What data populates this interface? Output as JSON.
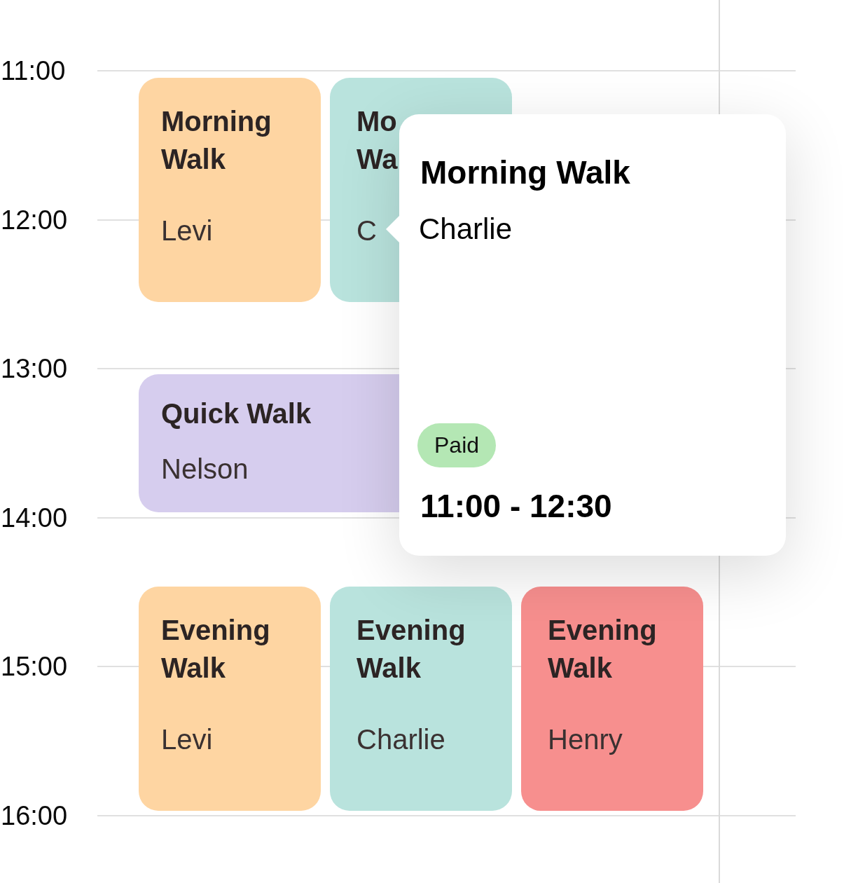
{
  "time_axis": {
    "labels": [
      "11:00",
      "12:00",
      "13:00",
      "14:00",
      "15:00",
      "16:00"
    ]
  },
  "event_rows": [
    {
      "events": [
        {
          "kind": "full",
          "title": "Morning Walk",
          "name": "Levi",
          "color": "#fed5a2"
        },
        {
          "kind": "covered",
          "title": "Mo Wa",
          "name": "C",
          "color": "#b9e3dd"
        }
      ]
    },
    {
      "events": [
        {
          "kind": "full",
          "title": "Quick Walk",
          "name": "Nelson",
          "color": "#d6cdee"
        }
      ]
    },
    {
      "events": [
        {
          "kind": "full",
          "title": "Evening Walk",
          "name": "Levi",
          "color": "#fed5a2"
        },
        {
          "kind": "full",
          "title": "Evening Walk",
          "name": "Charlie",
          "color": "#b9e3dd"
        },
        {
          "kind": "full",
          "title": "Evening Walk",
          "name": "Henry",
          "color": "#f78f8e"
        }
      ]
    }
  ],
  "popover": {
    "title": "Morning Walk",
    "name": "Charlie",
    "status": "Paid",
    "time_range": "11:00 - 12:30"
  }
}
